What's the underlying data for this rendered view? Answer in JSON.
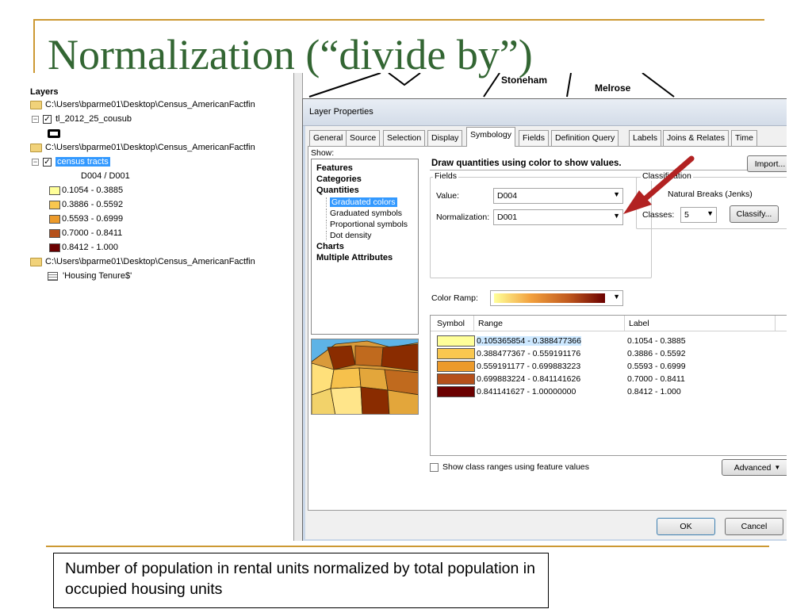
{
  "slide": {
    "title": "Normalization (“divide by”)",
    "caption": "Number of population in rental units normalized by total population in occupied housing units"
  },
  "toc": {
    "header": "Layers",
    "items": [
      {
        "type": "folder",
        "label": "C:\\Users\\bparme01\\Desktop\\Census_AmericanFactfin"
      },
      {
        "type": "layer",
        "label": "tl_2012_25_cousub",
        "checked": true
      },
      {
        "type": "folder",
        "label": "C:\\Users\\bparme01\\Desktop\\Census_AmericanFactfin"
      },
      {
        "type": "layer",
        "label": "census tracts",
        "checked": true,
        "selected": true
      },
      {
        "type": "folder",
        "label": "C:\\Users\\bparme01\\Desktop\\Census_AmericanFactfin"
      },
      {
        "type": "table",
        "label": "'Housing Tenure$'"
      }
    ],
    "legend_field": "D004 / D001",
    "legend": [
      {
        "label": "0.1054 - 0.3885",
        "color": "#ffff99"
      },
      {
        "label": "0.3886 - 0.5592",
        "color": "#f9c74f"
      },
      {
        "label": "0.5593 - 0.6999",
        "color": "#ec9a2a"
      },
      {
        "label": "0.7000 - 0.8411",
        "color": "#b5501a"
      },
      {
        "label": "0.8412 - 1.000",
        "color": "#6b0000"
      }
    ]
  },
  "map_labels": {
    "town1": "Stoneham",
    "town2": "Melrose"
  },
  "dialog": {
    "title": "Layer Properties",
    "tabs": [
      "General",
      "Source",
      "Selection",
      "Display",
      "Symbology",
      "Fields",
      "Definition Query",
      "Labels",
      "Joins & Relates",
      "Time"
    ],
    "active_tab": "Symbology",
    "show_label": "Show:",
    "show_items": [
      "Features",
      "Categories",
      "Quantities"
    ],
    "quantities_subitems": [
      "Graduated colors",
      "Graduated symbols",
      "Proportional symbols",
      "Dot density"
    ],
    "selected_subitem": "Graduated colors",
    "show_items_after": [
      "Charts",
      "Multiple Attributes"
    ],
    "draw_title": "Draw quantities using color to show values.",
    "import_label": "Import...",
    "fields_caption": "Fields",
    "value_label": "Value:",
    "value": "D004",
    "normalization_label": "Normalization:",
    "normalization": "D001",
    "classification_caption": "Classification",
    "classification_method": "Natural Breaks (Jenks)",
    "classes_label": "Classes:",
    "classes": "5",
    "classify_label": "Classify...",
    "color_ramp_label": "Color Ramp:",
    "columns": {
      "symbol": "Symbol",
      "range": "Range",
      "label": "Label"
    },
    "classes_table": [
      {
        "range": "0.105365854 - 0.388477366",
        "label": "0.1054 - 0.3885",
        "color": "#ffff99"
      },
      {
        "range": "0.388477367 - 0.559191176",
        "label": "0.3886 - 0.5592",
        "color": "#f9c74f"
      },
      {
        "range": "0.559191177 - 0.699883223",
        "label": "0.5593 - 0.6999",
        "color": "#ec9a2a"
      },
      {
        "range": "0.699883224 - 0.841141626",
        "label": "0.7000 - 0.8411",
        "color": "#b5501a"
      },
      {
        "range": "0.841141627 - 1.00000000",
        "label": "0.8412 - 1.000",
        "color": "#6b0000"
      }
    ],
    "show_ranges_label": "Show class ranges using feature values",
    "advanced_label": "Advanced",
    "ok_label": "OK",
    "cancel_label": "Cancel"
  },
  "colors": {
    "title": "#336633",
    "rule": "#cc9933",
    "selection": "#3399ff",
    "arrow": "#b22222"
  }
}
